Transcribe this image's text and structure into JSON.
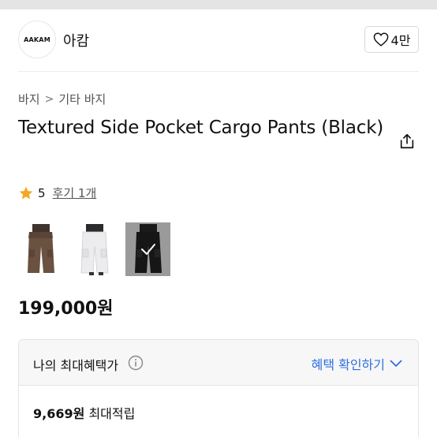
{
  "brand": {
    "logo_text": "AAKAM",
    "name": "아캄",
    "like_count": "4만"
  },
  "breadcrumb": {
    "level1": "바지",
    "separator": ">",
    "level2": "기타 바지"
  },
  "product": {
    "title": "Textured Side Pocket Cargo Pants (Black)",
    "rating": "5",
    "review_label": "후기 1개",
    "price": "199,000원",
    "thumbnails": [
      {
        "color": "brown",
        "selected": false
      },
      {
        "color": "white",
        "selected": false
      },
      {
        "color": "black",
        "selected": true
      }
    ]
  },
  "benefit": {
    "title": "나의 최대혜택가",
    "link_label": "혜택 확인하기",
    "points_amount": "9,669원",
    "points_label": "최대적립"
  },
  "colors": {
    "accent_blue": "#2f6fe0",
    "star": "#f5a623"
  }
}
